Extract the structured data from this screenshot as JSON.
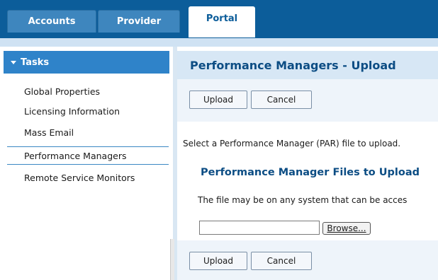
{
  "tabs": [
    {
      "label": "Accounts"
    },
    {
      "label": "Provider"
    },
    {
      "label": "Portal"
    }
  ],
  "sidebar": {
    "header": "Tasks",
    "items": [
      {
        "label": "Global Properties"
      },
      {
        "label": "Licensing Information"
      },
      {
        "label": "Mass Email"
      },
      {
        "label": "Performance Managers"
      },
      {
        "label": "Remote Service Monitors"
      }
    ],
    "selected": "Performance Managers"
  },
  "main": {
    "title": "Performance Managers - Upload",
    "upload_label": "Upload",
    "cancel_label": "Cancel",
    "instruction": "Select a Performance Manager (PAR) file to upload.",
    "section_heading": "Performance Manager Files to Upload",
    "description": "The file may be on any system that can be acces",
    "file_value": "",
    "browse_label": "Browse..."
  },
  "colors": {
    "top_bar": "#0c5d9a",
    "accent": "#2f83c9",
    "heading_text": "#0c4d84",
    "panel_bg": "#d7e7f5"
  }
}
